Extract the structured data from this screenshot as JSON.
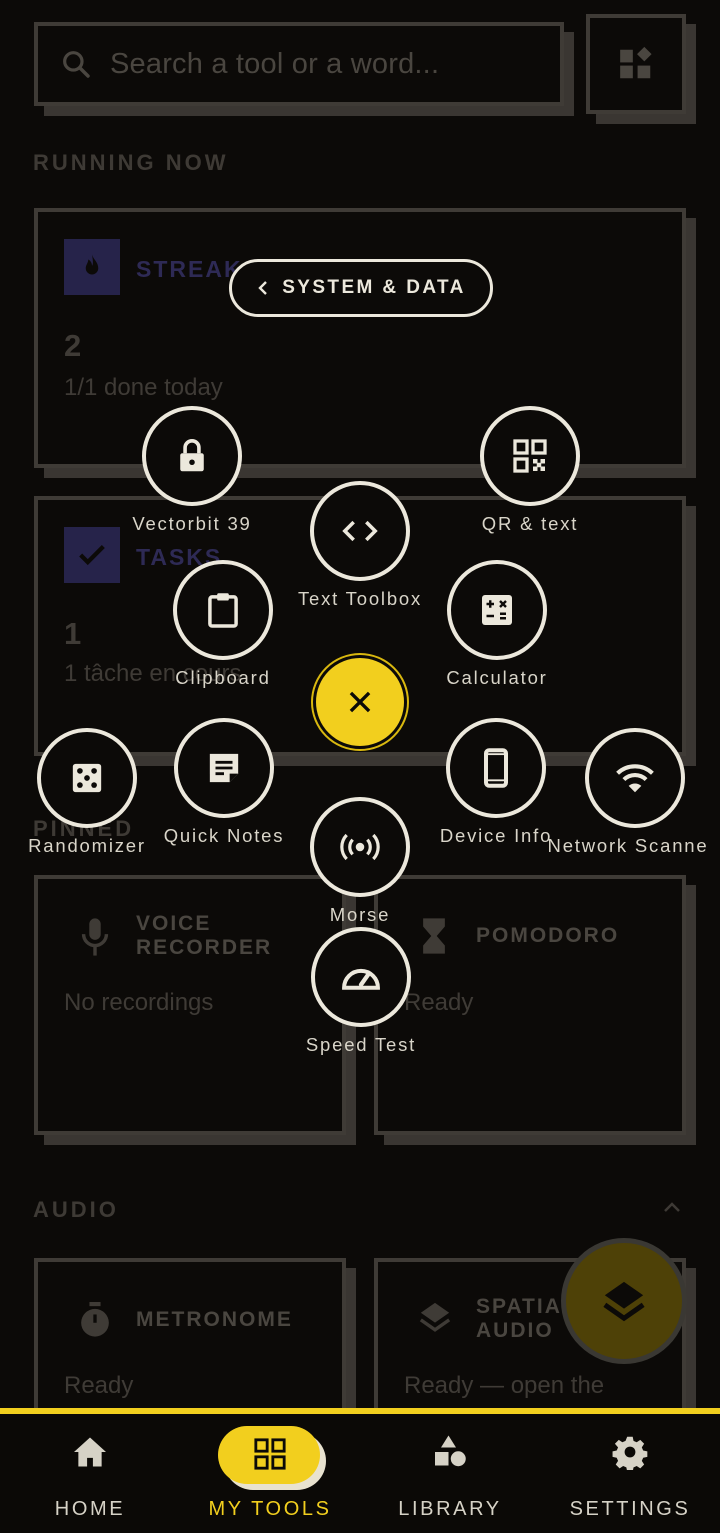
{
  "search": {
    "placeholder": "Search a tool or a word..."
  },
  "sections": {
    "running_now": "RUNNING NOW",
    "pinned": "PINNED",
    "audio": "AUDIO"
  },
  "cards": {
    "streak": {
      "title": "STREAK",
      "value": "2",
      "subtitle": "1/1 done today"
    },
    "tasks": {
      "title": "TASKS",
      "value": "1",
      "subtitle": "1 tâche en cours"
    },
    "voice_recorder": {
      "title_line1": "VOICE",
      "title_line2": "RECORDER",
      "subtitle": "No recordings"
    },
    "pomodoro": {
      "title": "POMODORO",
      "subtitle": "Ready"
    },
    "metronome": {
      "title": "METRONOME",
      "subtitle": "Ready"
    },
    "spatial_audio": {
      "title_line1": "SPATIAL",
      "title_line2": "AUDIO",
      "subtitle": "Ready — open the"
    }
  },
  "tool_menu": {
    "category": "SYSTEM & DATA",
    "tools": [
      {
        "label": "Vectorbit 39",
        "icon": "lock-icon"
      },
      {
        "label": "QR & text",
        "icon": "qr-code-icon"
      },
      {
        "label": "Text Toolbox",
        "icon": "code-icon"
      },
      {
        "label": "Clipboard",
        "icon": "clipboard-icon"
      },
      {
        "label": "Calculator",
        "icon": "calculator-icon"
      },
      {
        "label": "Randomizer",
        "icon": "dice-icon"
      },
      {
        "label": "Quick Notes",
        "icon": "note-icon"
      },
      {
        "label": "Device Info",
        "icon": "smartphone-icon"
      },
      {
        "label": "Network Scanne",
        "icon": "wifi-icon"
      },
      {
        "label": "Morse",
        "icon": "broadcast-icon"
      },
      {
        "label": "Speed Test",
        "icon": "speedometer-icon"
      }
    ]
  },
  "nav": [
    {
      "label": "HOME",
      "icon": "home-icon",
      "active": false
    },
    {
      "label": "MY TOOLS",
      "icon": "grid-icon",
      "active": true
    },
    {
      "label": "LIBRARY",
      "icon": "shapes-icon",
      "active": false
    },
    {
      "label": "SETTINGS",
      "icon": "gear-icon",
      "active": false
    }
  ],
  "colors": {
    "accent": "#f2cf1e",
    "ring": "#ece8dc",
    "background": "#0c0a08",
    "badge": "#26234a"
  }
}
